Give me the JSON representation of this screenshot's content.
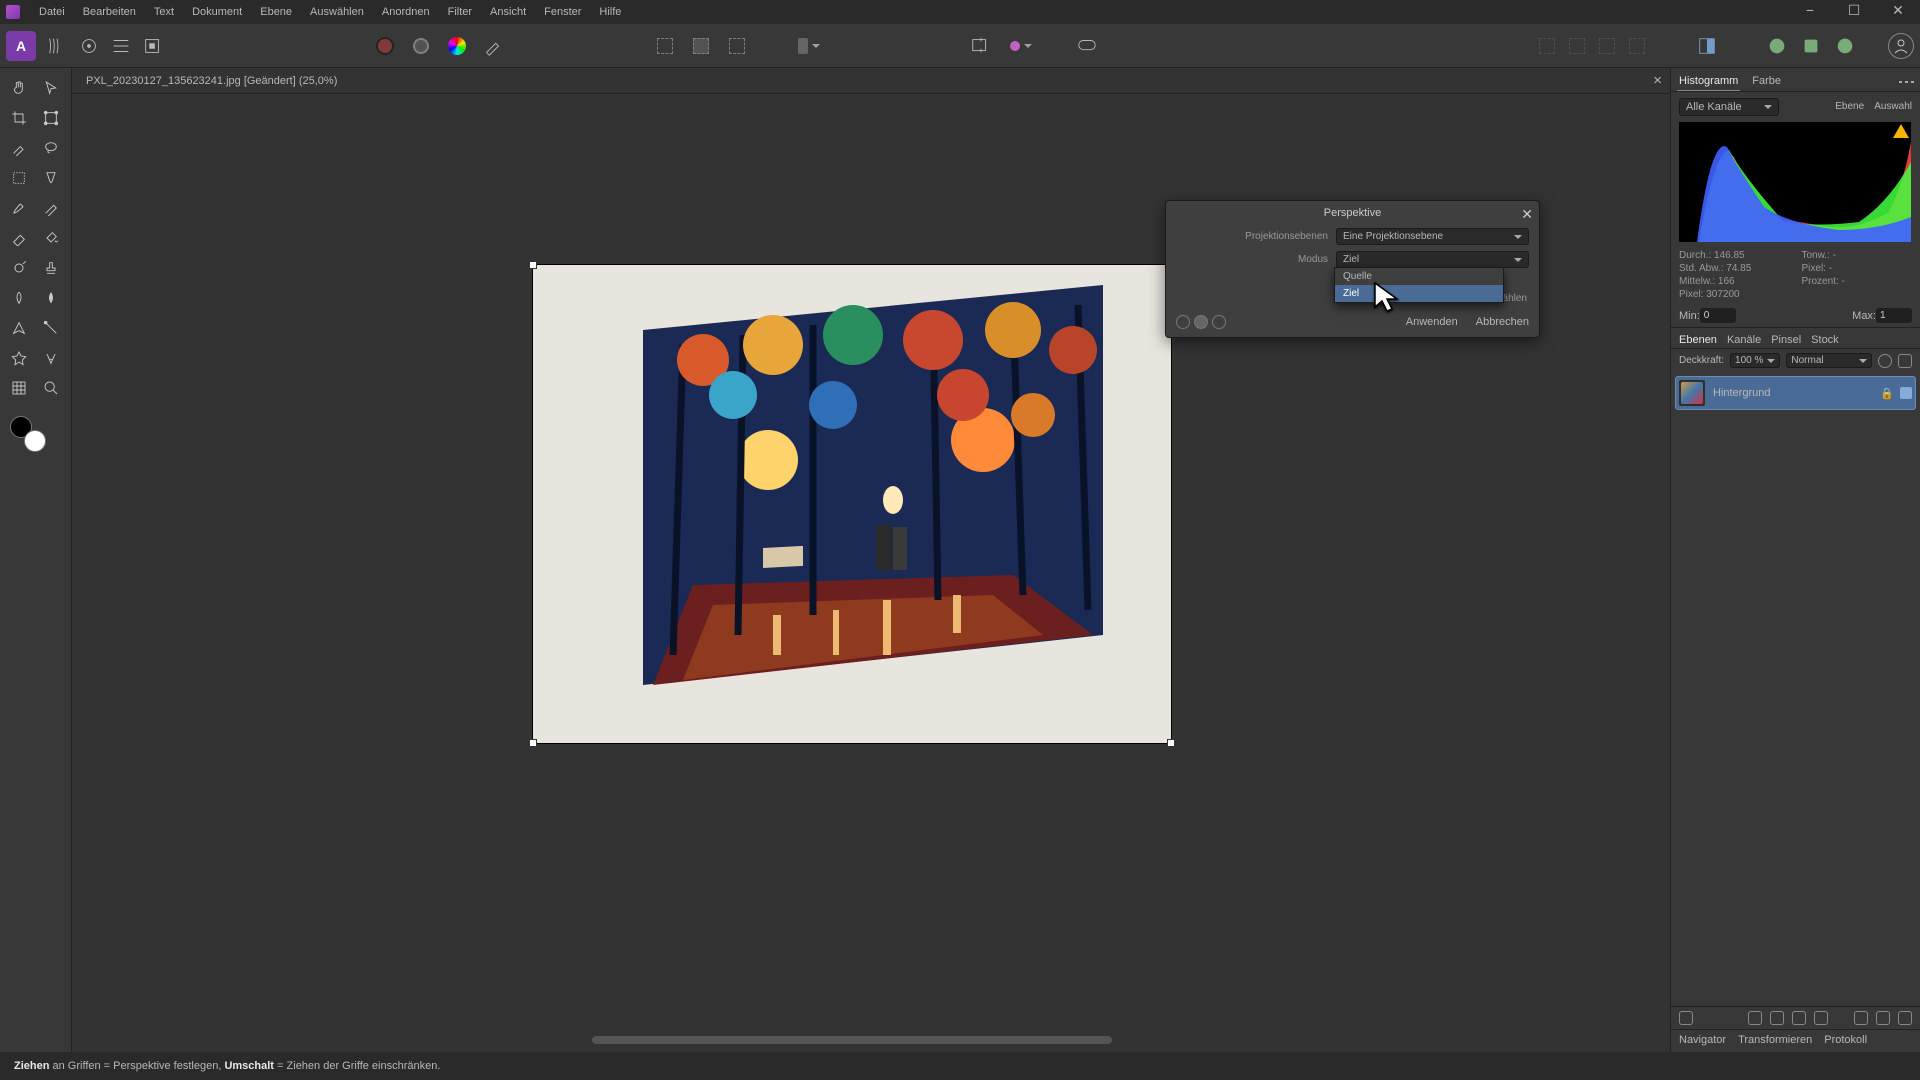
{
  "menu": {
    "items": [
      "Datei",
      "Bearbeiten",
      "Text",
      "Dokument",
      "Ebene",
      "Auswählen",
      "Anordnen",
      "Filter",
      "Ansicht",
      "Fenster",
      "Hilfe"
    ]
  },
  "app_logo_letter": "A",
  "document_tab": {
    "filename": "PXL_20230127_135623241.jpg [Geändert] (25,0%)"
  },
  "dialog": {
    "title": "Perspektive",
    "proj_label": "Projektionsebenen",
    "proj_value": "Eine Projektionsebene",
    "mode_label": "Modus",
    "mode_value": "Ziel",
    "mode_options": {
      "opt0": "Quelle",
      "opt1": "Ziel"
    },
    "auto_select": "Ziel auswählen",
    "apply": "Anwenden",
    "cancel": "Abbrechen"
  },
  "hist": {
    "tab_histogram": "Histogramm",
    "tab_color": "Farbe",
    "channel": "Alle Kanäle",
    "link_ebene": "Ebene",
    "link_auswahl": "Auswahl",
    "stat_durch_lbl": "Durch.:",
    "stat_durch": "146.85",
    "stat_ton_lbl": "Tonw.:",
    "stat_ton": "-",
    "stat_std_lbl": "Std. Abw.:",
    "stat_std": "74.85",
    "stat_pixelr_lbl": "Pixel:",
    "stat_pixelr": "-",
    "stat_mittel_lbl": "Mittelw.:",
    "stat_mittel": "166",
    "stat_proz_lbl": "Prozent:",
    "stat_proz": "-",
    "stat_pixel_lbl": "Pixel:",
    "stat_pixel": "307200",
    "min_label": "Min:",
    "min_value": "0",
    "max_label": "Max:",
    "max_value": "1"
  },
  "layers": {
    "tabs": {
      "ebenen": "Ebenen",
      "kanale": "Kanäle",
      "pinsel": "Pinsel",
      "stock": "Stock"
    },
    "opacity_label": "Deckkraft:",
    "opacity_value": "100 %",
    "blend_value": "Normal",
    "layer0": "Hintergrund"
  },
  "right_bottom_tabs": {
    "nav": "Navigator",
    "trans": "Transformieren",
    "prot": "Protokoll"
  },
  "status": {
    "s1": "Ziehen",
    "s2": " an Griffen = Perspektive festlegen, ",
    "s3": "Umschalt",
    "s4": " = Ziehen der Griffe einschränken."
  }
}
